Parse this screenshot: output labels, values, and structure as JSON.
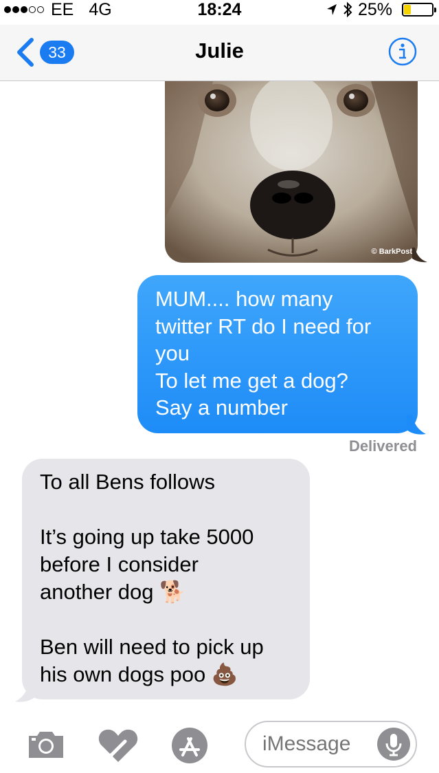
{
  "status": {
    "signal_dots": [
      true,
      true,
      true,
      false,
      false
    ],
    "carrier": "EE",
    "network": "4G",
    "time": "18:24",
    "battery_percent": "25%",
    "battery_level": 0.25,
    "icons": [
      "location-icon",
      "bluetooth-icon",
      "battery-icon"
    ]
  },
  "nav": {
    "back_count": "33",
    "title": "Julie",
    "info_icon": "info-icon"
  },
  "photo": {
    "watermark": "© BarkPost",
    "description_icon": "dog-photo"
  },
  "sent_message": {
    "text": "MUM.... how many\ntwitter RT do I need for\nyou\nTo let me get a dog?\nSay a number",
    "status": "Delivered"
  },
  "received_message": {
    "text_1": "To all Bens follows",
    "text_2": "It’s going up take 5000\nbefore I consider\nanother dog ",
    "emoji_1": "🐕",
    "text_3": "Ben will need to pick up\nhis own dogs poo ",
    "emoji_2": "💩"
  },
  "input_bar": {
    "placeholder": "iMessage",
    "icons": [
      "camera-icon",
      "digital-touch-icon",
      "app-store-icon",
      "microphone-icon"
    ]
  },
  "colors": {
    "accent": "#1a7cf0",
    "sent_bubble": "#2d98f9",
    "received_bubble": "#e5e5ea",
    "battery_fill": "#f5d300"
  }
}
